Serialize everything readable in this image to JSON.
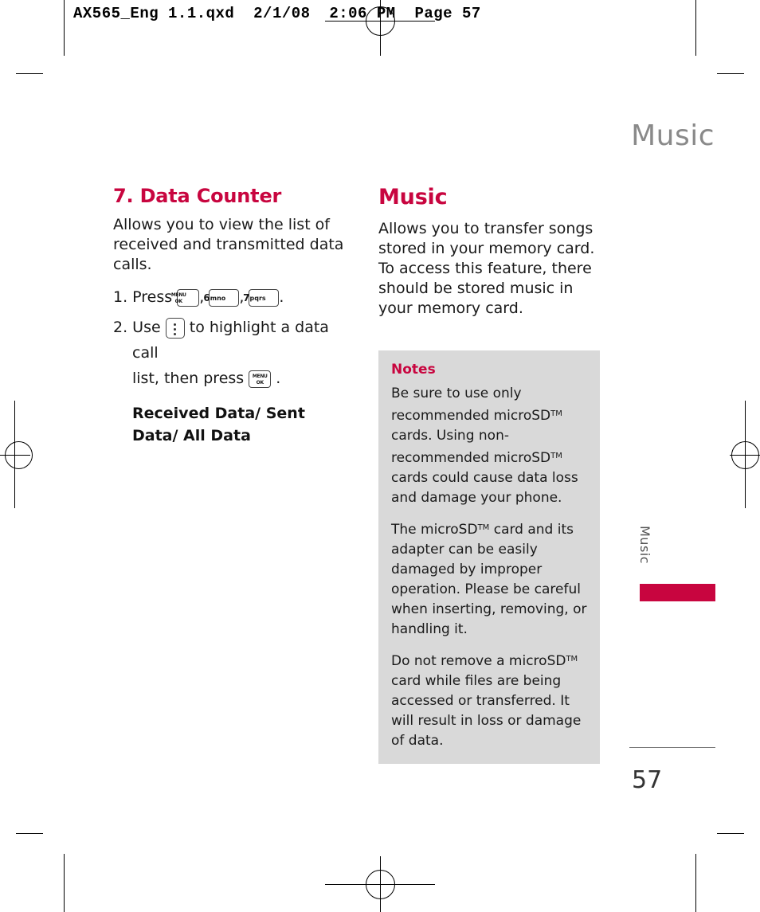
{
  "file_header": "AX565_Eng 1.1.qxd  2/1/08  2:06 PM  Page 57",
  "running_head": "Music",
  "left_column": {
    "heading": "7. Data Counter",
    "intro": "Allows you to view the list of received and transmitted data calls.",
    "step1_prefix": "1. Press",
    "step1_comma1": ",",
    "step1_comma2": ",",
    "step1_period": ".",
    "step2_prefix": "2. Use",
    "step2_mid": "to highlight a data call",
    "step2_cont": "list, then press",
    "step2_period": ".",
    "options": "Received Data/ Sent Data/ All Data",
    "keys": {
      "menu_line1": "MENU",
      "menu_line2": "OK",
      "num6": "6",
      "num6_sub": "mno",
      "num7": "7",
      "num7_sub": "pqrs",
      "nav_icon": "nav-updown-icon"
    }
  },
  "right_column": {
    "heading": "Music",
    "intro": "Allows you to transfer songs stored in your memory card. To access this feature, there should be stored music in your memory card.",
    "notes": {
      "title": "Notes",
      "items": [
        "Be sure to use only recommended microSD™ cards. Using non-recommended microSD™ cards could cause data loss and damage your phone.",
        "The microSD™ card and its adapter can be easily damaged by improper operation. Please be careful when inserting, removing, or handling it.",
        "Do not remove a microSD™ card while files are being accessed or transferred. It will result in loss or damage of data."
      ]
    }
  },
  "side_tab": {
    "label": "Music",
    "color": "#c8053f"
  },
  "page_number": "57",
  "colors": {
    "accent": "#c8053f",
    "running_head": "#8a8a8a",
    "note_bg": "#d9d9d9"
  }
}
